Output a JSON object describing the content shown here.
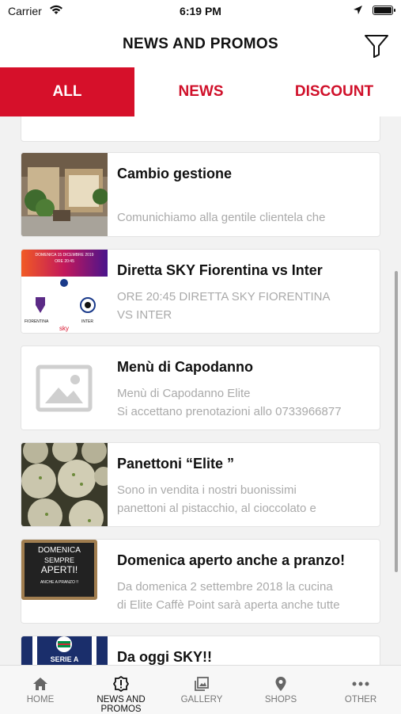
{
  "status": {
    "carrier": "Carrier",
    "time": "6:19 PM"
  },
  "header": {
    "title": "NEWS AND PROMOS"
  },
  "tabs": [
    {
      "label": "ALL"
    },
    {
      "label": "NEWS"
    },
    {
      "label": "DISCOUNT"
    }
  ],
  "items": [
    {
      "title": "Cambio gestione",
      "desc1": "Comunichiamo alla gentile clientela che",
      "desc2": ""
    },
    {
      "title": "Diretta SKY Fiorentina vs Inter",
      "desc1": "ORE 20:45 DIRETTA SKY FIORENTINA",
      "desc2": "VS INTER",
      "thumb": {
        "date": "DOMENICA 15 DICEMBRE 2019",
        "time": "ORE 20:45",
        "team1": "FIORENTINA",
        "team2": "INTER"
      }
    },
    {
      "title": "Menù di Capodanno",
      "desc1": "Menù di Capodanno Elite",
      "desc2": "Si accettano prenotazioni allo 0733966877"
    },
    {
      "title": "Panettoni “Elite ”",
      "desc1": "Sono in vendita i nostri buonissimi",
      "desc2": "panettoni al pistacchio, al cioccolato e"
    },
    {
      "title": "Domenica aperto anche a pranzo!",
      "desc1": "Da domenica 2 settembre 2018 la cucina",
      "desc2": "di Elite Caffè Point sarà aperta anche tutte",
      "thumb": {
        "line1": "DOMENICA",
        "line2": "SEMPRE",
        "line3": "APERTI!",
        "line4": "ANCHE A PRANZO !!"
      }
    },
    {
      "title": "Da oggi SKY!!",
      "desc1": "",
      "desc2": "",
      "thumb": {
        "label": "SERIE A"
      }
    }
  ],
  "tabbar": [
    {
      "label": "HOME",
      "icon": "home-icon"
    },
    {
      "label": "NEWS AND PROMOS",
      "icon": "alert-icon"
    },
    {
      "label": "GALLERY",
      "icon": "gallery-icon"
    },
    {
      "label": "SHOPS",
      "icon": "location-pin-icon"
    },
    {
      "label": "OTHER",
      "icon": "more-dots-icon"
    }
  ],
  "colors": {
    "accent": "#d6102a",
    "placeholder": "#cfcfcf",
    "muted": "#aaaaaa"
  }
}
